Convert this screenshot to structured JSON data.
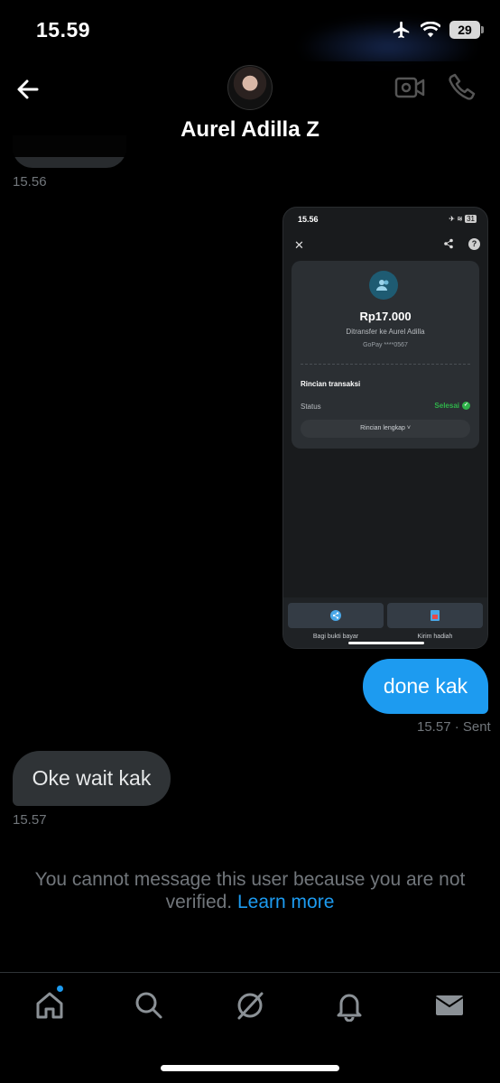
{
  "status_bar": {
    "time": "15.59",
    "battery": "29"
  },
  "header": {
    "contact_name": "Aurel Adilla Z"
  },
  "messages": {
    "prev_timestamp": "15.56",
    "sent_timestamp": "15.57 · Sent",
    "sent_text": "done kak",
    "received_text": "Oke wait kak",
    "received_timestamp": "15.57"
  },
  "shared_screenshot": {
    "time": "15.56",
    "battery": "31",
    "amount": "Rp17.000",
    "transfer_to": "Ditransfer ke Aurel Adilla",
    "account": "GoPay ****0567",
    "section_title": "Rincian transaksi",
    "status_label": "Status",
    "status_value": "Selesai",
    "details_button": "Rincian lengkap ˅",
    "share_label": "Bagi bukti bayar",
    "gift_label": "Kirim hadiah"
  },
  "notice": {
    "text": "You cannot message this user because you are not verified.",
    "link": "Learn more"
  },
  "colors": {
    "accent": "#1d9bf0",
    "bubble_in": "#2f3336",
    "success": "#2fb34a"
  }
}
